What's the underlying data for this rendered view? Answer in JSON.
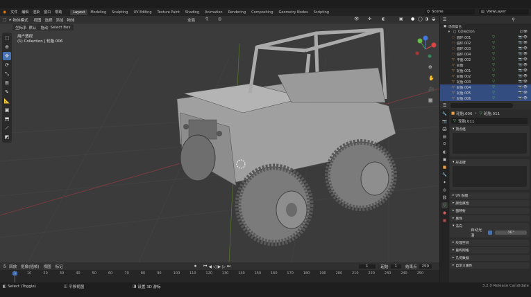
{
  "menu": [
    "文件",
    "编辑",
    "渲染",
    "窗口",
    "帮助"
  ],
  "workspaces": [
    "Layout",
    "Modeling",
    "Sculpting",
    "UV Editing",
    "Texture Paint",
    "Shading",
    "Animation",
    "Rendering",
    "Compositing",
    "Geometry Nodes",
    "Scripting"
  ],
  "active_workspace": "Layout",
  "scene_name": "Scene",
  "view_layer": "ViewLayer",
  "viewport_header": {
    "mode": "物体模式",
    "menus": [
      "视图",
      "选择",
      "添加",
      "物体"
    ],
    "orientation_label": "坐标系",
    "orientation_value": "默认",
    "drag_label": "拖动",
    "drag_value": "Select Box",
    "transform_pivot": "全局"
  },
  "viewport_overlay": {
    "title": "用户透视",
    "subtitle": "(1) Collection | 轮胎.006"
  },
  "outliner": {
    "header_title": "场景集合",
    "collection": "Collection",
    "items": [
      {
        "name": "圆环.001",
        "icon": "torus-icon",
        "selected": false
      },
      {
        "name": "圆环.002",
        "icon": "torus-icon",
        "selected": false
      },
      {
        "name": "圆环.003",
        "icon": "torus-icon",
        "selected": false
      },
      {
        "name": "圆环.004",
        "icon": "torus-icon",
        "selected": false
      },
      {
        "name": "平面.002",
        "icon": "mesh-icon",
        "selected": false
      },
      {
        "name": "轮胎",
        "icon": "mesh-icon",
        "selected": false
      },
      {
        "name": "轮胎.001",
        "icon": "mesh-icon",
        "selected": false
      },
      {
        "name": "轮胎.002",
        "icon": "mesh-icon",
        "selected": false
      },
      {
        "name": "轮胎.003",
        "icon": "mesh-icon",
        "selected": false
      },
      {
        "name": "轮胎.004",
        "icon": "mesh-icon",
        "selected": true
      },
      {
        "name": "轮胎.005",
        "icon": "mesh-icon",
        "selected": true
      },
      {
        "name": "轮胎.006",
        "icon": "mesh-icon",
        "selected": true
      }
    ]
  },
  "properties": {
    "breadcrumb_a": "轮胎.006",
    "breadcrumb_b": "轮胎.011",
    "data_name": "轮胎.011",
    "panels": [
      {
        "title": "顶点组",
        "expanded": true
      },
      {
        "title": "形态键",
        "expanded": true
      },
      {
        "title": "UV 贴图",
        "expanded": false
      },
      {
        "title": "颜色属性",
        "expanded": false
      },
      {
        "title": "面映射",
        "expanded": false
      },
      {
        "title": "属性",
        "expanded": false
      },
      {
        "title": "法向",
        "expanded": true
      },
      {
        "title": "纹理空间",
        "expanded": false
      },
      {
        "title": "重构网格",
        "expanded": false
      },
      {
        "title": "几何数据",
        "expanded": false
      },
      {
        "title": "自定义属性",
        "expanded": false
      }
    ],
    "autosmooth_label": "自动光滑",
    "autosmooth_angle": "30°"
  },
  "timeline": {
    "menus": [
      "回放",
      "抠像(插帧)",
      "视图",
      "标记"
    ],
    "current_frame": "1",
    "start_label": "起始",
    "start_value": "1",
    "end_label": "结束点",
    "end_value": "250",
    "ticks": [
      "1",
      "10",
      "20",
      "30",
      "40",
      "50",
      "60",
      "70",
      "80",
      "90",
      "100",
      "110",
      "120",
      "130",
      "140",
      "150",
      "160",
      "170",
      "180",
      "190",
      "200",
      "210",
      "220",
      "230",
      "240",
      "250"
    ]
  },
  "statusbar": {
    "select": "Select (Toggle)",
    "pan": "平移视图",
    "context": "设置 3D 游标",
    "version": "3.2.0 Release Candidate"
  },
  "colors": {
    "accent": "#4772b3",
    "bg": "#3b3b3b",
    "selected_row": "#334d80"
  }
}
